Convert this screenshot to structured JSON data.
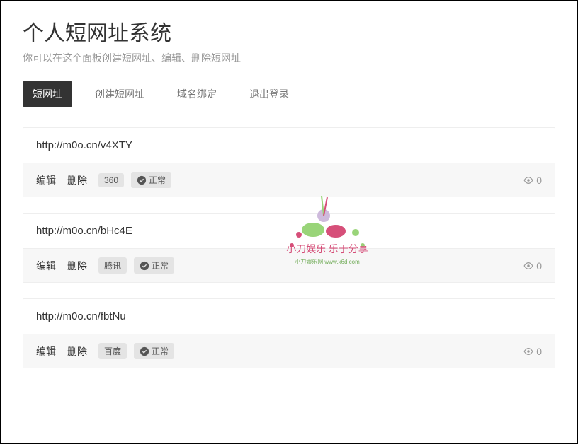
{
  "title": "个人短网址系统",
  "subtitle": "你可以在这个面板创建短网址、编辑、删除短网址",
  "tabs": [
    {
      "label": "短网址",
      "active": true
    },
    {
      "label": "创建短网址",
      "active": false
    },
    {
      "label": "域名绑定",
      "active": false
    },
    {
      "label": "退出登录",
      "active": false
    }
  ],
  "actions": {
    "edit": "编辑",
    "delete": "删除"
  },
  "status_ok": "正常",
  "entries": [
    {
      "url": "http://m0o.cn/v4XTY",
      "source": "360",
      "views": 0
    },
    {
      "url": "http://m0o.cn/bHc4E",
      "source": "腾讯",
      "views": 0
    },
    {
      "url": "http://m0o.cn/fbtNu",
      "source": "百度",
      "views": 0
    }
  ],
  "watermark": {
    "text_main": "小刀娱乐 乐于分享",
    "text_sub": "小刀娱乐网 www.x6d.com"
  }
}
